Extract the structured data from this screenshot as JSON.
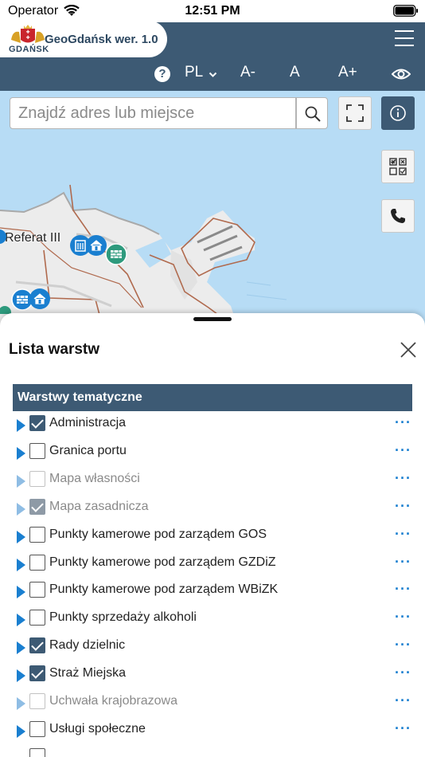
{
  "status_bar": {
    "carrier": "Operator",
    "time": "12:51 PM"
  },
  "header": {
    "app_title": "GeoGdańsk wer. 1.0",
    "city_name": "GDAŃSK"
  },
  "toolbar": {
    "help": "?",
    "language": "PL",
    "font_decrease": "A-",
    "font_default": "A",
    "font_increase": "A+"
  },
  "search": {
    "placeholder": "Znajdź adres lub miejsce"
  },
  "map": {
    "label": "Referat III"
  },
  "layers_panel": {
    "title": "Lista warstw",
    "group_title": "Warstwy tematyczne",
    "more_label": "···",
    "layers": [
      {
        "label": "Administracja",
        "checked": true,
        "enabled": true
      },
      {
        "label": "Granica portu",
        "checked": false,
        "enabled": true
      },
      {
        "label": "Mapa własności",
        "checked": false,
        "enabled": false
      },
      {
        "label": "Mapa zasadnicza",
        "checked": true,
        "enabled": false
      },
      {
        "label": "Punkty kamerowe pod zarządem GOS",
        "checked": false,
        "enabled": true
      },
      {
        "label": "Punkty kamerowe pod zarządem GZDiZ",
        "checked": false,
        "enabled": true
      },
      {
        "label": "Punkty kamerowe pod zarządem WBiZK",
        "checked": false,
        "enabled": true
      },
      {
        "label": "Punkty sprzedaży alkoholi",
        "checked": false,
        "enabled": true
      },
      {
        "label": "Rady dzielnic",
        "checked": true,
        "enabled": true
      },
      {
        "label": "Straż Miejska",
        "checked": true,
        "enabled": true
      },
      {
        "label": "Uchwała krajobrazowa",
        "checked": false,
        "enabled": false
      },
      {
        "label": "Usługi społeczne",
        "checked": false,
        "enabled": true
      }
    ]
  },
  "colors": {
    "header": "#3d5a74",
    "accent": "#1a7fd0",
    "water": "#b7dcf5",
    "land": "#ececec",
    "district_border": "#b06a4e"
  }
}
